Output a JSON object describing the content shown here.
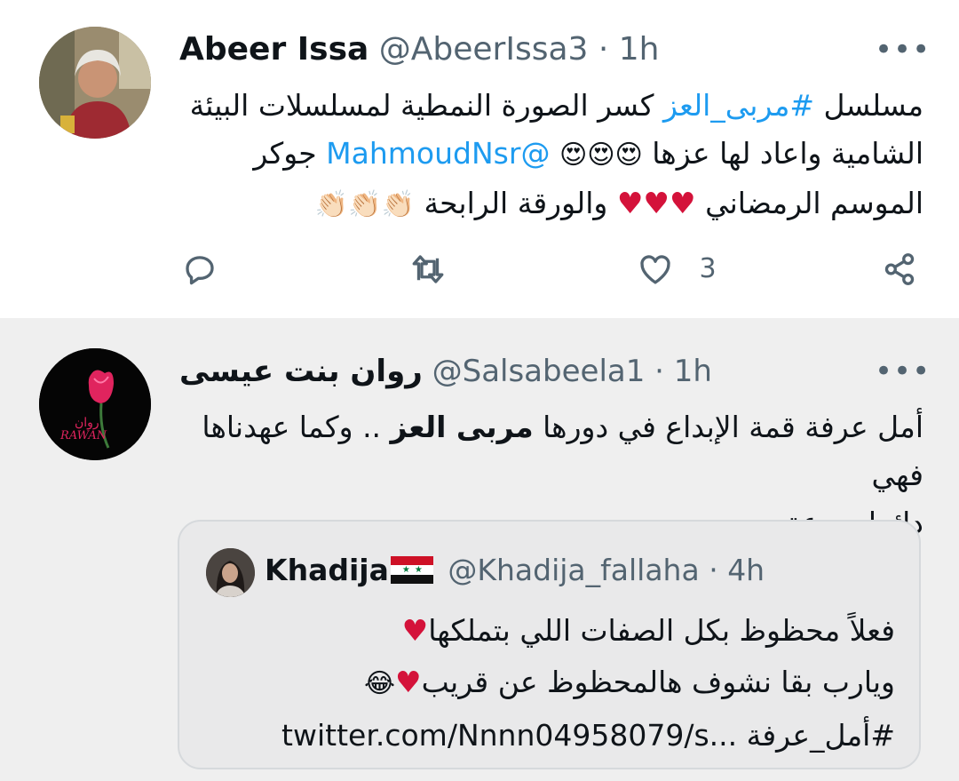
{
  "tweet1": {
    "name": "Abeer Issa",
    "handle": "@AbeerIssa3",
    "separator": "·",
    "time": "1h",
    "more": "•••",
    "line1_text": "مسلسل ",
    "line1_hashtag": "#مربى_العز",
    "line1_rest": " كسر الصورة النمطية لمسلسلات البيئة",
    "line2_text": "الشامية واعاد لها عزها ",
    "line2_emojis": "😍😍😍",
    "line2_mention": "@MahmoudNsr",
    "line2_rest": " جوكر",
    "line3_text": "الموسم الرمضاني ",
    "line3_hearts": "♥♥♥",
    "line3_mid": " والورقة الرابحة ",
    "line3_claps": "👏🏻👏🏻👏🏻",
    "actions": {
      "reply_icon": "reply-icon",
      "retweet_icon": "retweet-icon",
      "like_icon": "heart-icon",
      "like_count": "3",
      "share_icon": "share-icon"
    }
  },
  "tweet2": {
    "name": "روان بنت عيسى",
    "handle": "@Salsabeela1",
    "separator": "·",
    "time": "1h",
    "more": "•••",
    "line1_text": "أمل عرفة قمة الإبداع في دورها ",
    "line1_bold": "مربى العز",
    "line1_rest": " .. وكما عهدناها فهي",
    "line2": "دائما مبدعة",
    "avatar_caption": "روان",
    "avatar_logo": "RAWAN"
  },
  "quote": {
    "name": "Khadija",
    "flag": "syria-flag-icon",
    "handle": "@Khadija_fallaha",
    "separator": "·",
    "time": "4h",
    "line1": "فعلاً محظوظ بكل الصفات اللي بتملكها",
    "line1_emoji": "♥",
    "line2": "ويارب بقا نشوف هالمحظوظ عن قريب",
    "line2_emoji1": "♥",
    "line2_emoji2": "😂",
    "line3_hashtag": "#أمل_عرفة",
    "line3_link": "twitter.com/Nnnn04958079/s..."
  },
  "colors": {
    "link": "#1d9bf0",
    "secondary_text": "#536471",
    "heart": "#d4123a"
  }
}
